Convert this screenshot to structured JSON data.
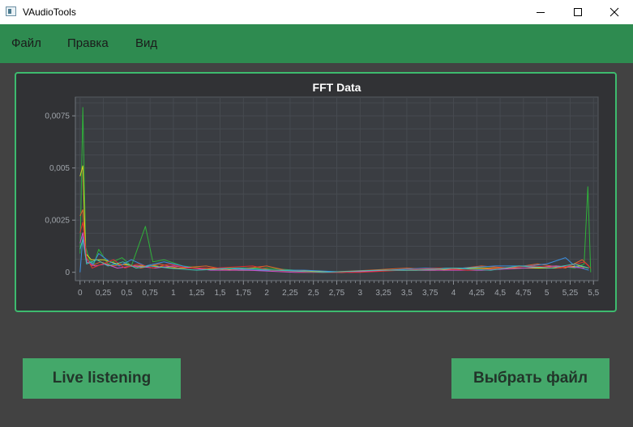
{
  "window": {
    "title": "VAudioTools",
    "icons": {
      "app": "app-icon",
      "minimize": "minimize-icon",
      "maximize": "maximize-icon",
      "close": "close-icon"
    }
  },
  "menu": {
    "items": [
      {
        "label": "Файл"
      },
      {
        "label": "Правка"
      },
      {
        "label": "Вид"
      }
    ],
    "background": "#2e8b50"
  },
  "chart_data": {
    "type": "line",
    "title": "FFT Data",
    "xlabel": "",
    "ylabel": "",
    "xlim": [
      -0.05,
      5.55
    ],
    "ylim": [
      -0.0004,
      0.0084
    ],
    "grid": true,
    "legend": "none",
    "x_ticks": [
      "0",
      "0,25",
      "0,5",
      "0,75",
      "1",
      "1,25",
      "1,5",
      "1,75",
      "2",
      "2,25",
      "2,5",
      "2,75",
      "3",
      "3,25",
      "3,5",
      "3,75",
      "4",
      "4,25",
      "4,5",
      "4,75",
      "5",
      "5,25",
      "5,5"
    ],
    "y_ticks": [
      "0",
      "0,0025",
      "0,005",
      "0,0075"
    ],
    "series": [
      {
        "color": "#2fb23a",
        "values": [
          [
            0.0,
            0.0009
          ],
          [
            0.03,
            0.0079
          ],
          [
            0.06,
            0.0012
          ],
          [
            0.1,
            0.0006
          ],
          [
            0.15,
            0.0004
          ],
          [
            0.2,
            0.0011
          ],
          [
            0.3,
            0.0004
          ],
          [
            0.45,
            0.0007
          ],
          [
            0.55,
            0.0003
          ],
          [
            0.7,
            0.0022
          ],
          [
            0.78,
            0.0005
          ],
          [
            0.9,
            0.0006
          ],
          [
            1.1,
            0.0003
          ],
          [
            1.3,
            0.0002
          ],
          [
            1.6,
            0.0002
          ],
          [
            2.0,
            0.0002
          ],
          [
            2.3,
            0.0001
          ],
          [
            2.8,
            0.0
          ],
          [
            3.2,
            0.0001
          ],
          [
            3.6,
            0.0001
          ],
          [
            4.0,
            0.0002
          ],
          [
            4.4,
            0.0002
          ],
          [
            4.8,
            0.0002
          ],
          [
            5.1,
            0.0003
          ],
          [
            5.3,
            0.0002
          ],
          [
            5.4,
            0.0004
          ],
          [
            5.44,
            0.0041
          ],
          [
            5.47,
            0.0
          ]
        ]
      },
      {
        "color": "#d8d820",
        "values": [
          [
            0.0,
            0.0046
          ],
          [
            0.03,
            0.0051
          ],
          [
            0.06,
            0.0009
          ],
          [
            0.12,
            0.0006
          ],
          [
            0.25,
            0.0006
          ],
          [
            0.4,
            0.0004
          ],
          [
            0.6,
            0.0003
          ],
          [
            0.8,
            0.0003
          ],
          [
            1.0,
            0.0002
          ],
          [
            1.3,
            0.0002
          ],
          [
            1.7,
            0.0001
          ],
          [
            2.2,
            0.0001
          ],
          [
            2.8,
            0.0
          ],
          [
            3.3,
            0.0001
          ],
          [
            3.8,
            0.0001
          ],
          [
            4.2,
            0.0002
          ],
          [
            4.7,
            0.0002
          ],
          [
            5.1,
            0.0002
          ],
          [
            5.35,
            0.0003
          ],
          [
            5.45,
            0.0002
          ]
        ]
      },
      {
        "color": "#e0632a",
        "values": [
          [
            0.0,
            0.0027
          ],
          [
            0.03,
            0.003
          ],
          [
            0.06,
            0.0008
          ],
          [
            0.12,
            0.0003
          ],
          [
            0.22,
            0.0005
          ],
          [
            0.35,
            0.0003
          ],
          [
            0.5,
            0.0004
          ],
          [
            0.65,
            0.0002
          ],
          [
            0.85,
            0.0004
          ],
          [
            1.05,
            0.0002
          ],
          [
            1.35,
            0.0003
          ],
          [
            1.6,
            0.0001
          ],
          [
            2.0,
            0.0003
          ],
          [
            2.2,
            0.0001
          ],
          [
            2.6,
            0.0
          ],
          [
            3.1,
            0.0001
          ],
          [
            3.5,
            0.0002
          ],
          [
            3.9,
            0.0001
          ],
          [
            4.3,
            0.0003
          ],
          [
            4.6,
            0.0002
          ],
          [
            4.9,
            0.0004
          ],
          [
            5.2,
            0.0002
          ],
          [
            5.38,
            0.0006
          ],
          [
            5.45,
            0.0003
          ]
        ]
      },
      {
        "color": "#3a8ee0",
        "values": [
          [
            0.0,
            0.0
          ],
          [
            0.03,
            0.0017
          ],
          [
            0.07,
            0.0006
          ],
          [
            0.14,
            0.0004
          ],
          [
            0.2,
            0.0009
          ],
          [
            0.32,
            0.0005
          ],
          [
            0.42,
            0.0003
          ],
          [
            0.55,
            0.0006
          ],
          [
            0.7,
            0.0003
          ],
          [
            0.9,
            0.0005
          ],
          [
            1.2,
            0.0002
          ],
          [
            1.5,
            0.0002
          ],
          [
            1.9,
            0.0001
          ],
          [
            2.4,
            0.0001
          ],
          [
            2.9,
            0.0
          ],
          [
            3.3,
            0.0001
          ],
          [
            3.7,
            0.0002
          ],
          [
            4.1,
            0.0002
          ],
          [
            4.45,
            0.0003
          ],
          [
            4.8,
            0.0003
          ],
          [
            5.0,
            0.0004
          ],
          [
            5.2,
            0.0007
          ],
          [
            5.3,
            0.0003
          ],
          [
            5.45,
            0.0001
          ]
        ]
      },
      {
        "color": "#d050c8",
        "values": [
          [
            0.0,
            0.0014
          ],
          [
            0.03,
            0.0019
          ],
          [
            0.07,
            0.0005
          ],
          [
            0.16,
            0.0003
          ],
          [
            0.27,
            0.0004
          ],
          [
            0.4,
            0.0002
          ],
          [
            0.58,
            0.0003
          ],
          [
            0.8,
            0.0002
          ],
          [
            1.0,
            0.0003
          ],
          [
            1.4,
            0.0001
          ],
          [
            1.8,
            0.0001
          ],
          [
            2.3,
            0.0
          ],
          [
            2.8,
            0.0
          ],
          [
            3.4,
            0.0001
          ],
          [
            3.9,
            0.0001
          ],
          [
            4.3,
            0.0001
          ],
          [
            4.75,
            0.0002
          ],
          [
            5.1,
            0.0003
          ],
          [
            5.4,
            0.0002
          ]
        ]
      },
      {
        "color": "#e03030",
        "values": [
          [
            0.0,
            0.0019
          ],
          [
            0.03,
            0.0024
          ],
          [
            0.07,
            0.0007
          ],
          [
            0.13,
            0.0002
          ],
          [
            0.24,
            0.0004
          ],
          [
            0.36,
            0.0006
          ],
          [
            0.48,
            0.0002
          ],
          [
            0.62,
            0.0004
          ],
          [
            0.78,
            0.0002
          ],
          [
            0.95,
            0.0004
          ],
          [
            1.15,
            0.0002
          ],
          [
            1.45,
            0.0002
          ],
          [
            1.85,
            0.0003
          ],
          [
            2.05,
            0.0001
          ],
          [
            2.5,
            0.0
          ],
          [
            3.0,
            0.0
          ],
          [
            3.45,
            0.0001
          ],
          [
            3.85,
            0.0002
          ],
          [
            4.15,
            0.0001
          ],
          [
            4.5,
            0.0002
          ],
          [
            4.85,
            0.0003
          ],
          [
            5.15,
            0.0002
          ],
          [
            5.4,
            0.0005
          ],
          [
            5.47,
            0.0002
          ]
        ]
      },
      {
        "color": "#40c0b0",
        "values": [
          [
            0.0,
            0.0011
          ],
          [
            0.03,
            0.0016
          ],
          [
            0.07,
            0.0004
          ],
          [
            0.18,
            0.0006
          ],
          [
            0.3,
            0.0003
          ],
          [
            0.46,
            0.0005
          ],
          [
            0.6,
            0.0002
          ],
          [
            0.75,
            0.0003
          ],
          [
            0.95,
            0.0002
          ],
          [
            1.25,
            0.0001
          ],
          [
            1.7,
            0.0002
          ],
          [
            2.1,
            0.0001
          ],
          [
            2.6,
            0.0
          ],
          [
            3.2,
            0.0001
          ],
          [
            3.6,
            0.0001
          ],
          [
            4.0,
            0.0002
          ],
          [
            4.4,
            0.0001
          ],
          [
            4.7,
            0.0003
          ],
          [
            5.05,
            0.0002
          ],
          [
            5.3,
            0.0004
          ],
          [
            5.45,
            0.0002
          ]
        ]
      }
    ]
  },
  "buttons": {
    "live": "Live listening",
    "choose_file": "Выбрать файл"
  }
}
